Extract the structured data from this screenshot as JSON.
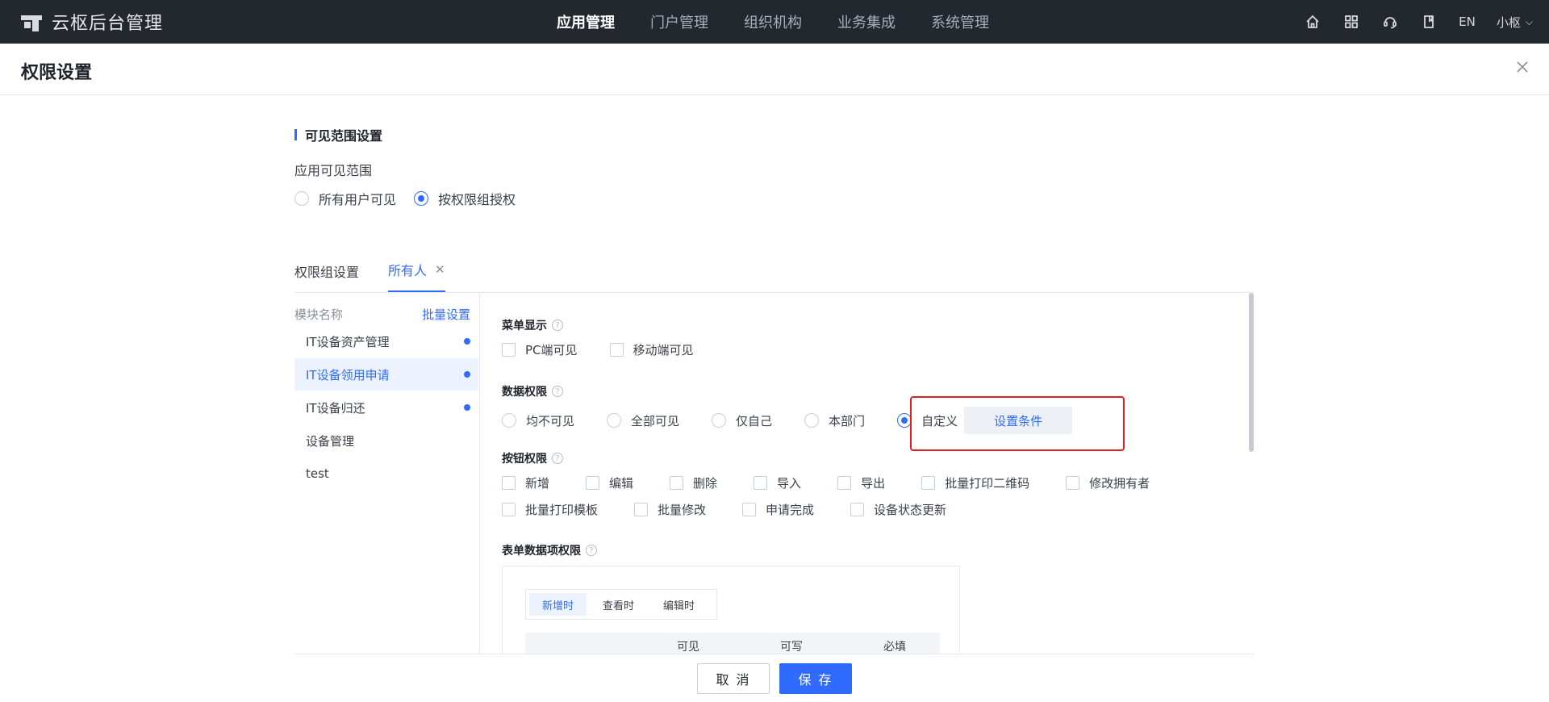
{
  "app": {
    "brand": "云枢后台管理"
  },
  "nav": [
    {
      "label": "应用管理",
      "active": true
    },
    {
      "label": "门户管理"
    },
    {
      "label": "组织机构"
    },
    {
      "label": "业务集成"
    },
    {
      "label": "系统管理"
    }
  ],
  "topright": {
    "lang": "EN",
    "user": "小枢"
  },
  "page": {
    "title": "权限设置"
  },
  "visibility": {
    "section_title": "可见范围设置",
    "label": "应用可见范围",
    "options": [
      {
        "label": "所有用户可见",
        "selected": false
      },
      {
        "label": "按权限组授权",
        "selected": true
      }
    ]
  },
  "tabs": [
    {
      "label": "权限组设置"
    },
    {
      "label": "所有人",
      "active": true
    }
  ],
  "modules": {
    "header": "模块名称",
    "batch": "批量设置",
    "items": [
      {
        "label": "IT设备资产管理",
        "dot": true
      },
      {
        "label": "IT设备领用申请",
        "dot": true,
        "selected": true
      },
      {
        "label": "IT设备归还",
        "dot": true
      },
      {
        "label": "设备管理",
        "dot": false
      },
      {
        "label": "test",
        "dot": false
      }
    ]
  },
  "menu_display": {
    "title": "菜单显示",
    "options": [
      "PC端可见",
      "移动端可见"
    ]
  },
  "data_permission": {
    "title": "数据权限",
    "options": [
      "均不可见",
      "全部可见",
      "仅自己",
      "本部门",
      "自定义"
    ],
    "selected": "自定义",
    "set_condition": "设置条件"
  },
  "button_permission": {
    "title": "按钮权限",
    "row1": [
      "新增",
      "编辑",
      "删除",
      "导入",
      "导出",
      "批量打印二维码",
      "修改拥有者"
    ],
    "row2": [
      "批量打印模板",
      "批量修改",
      "申请完成",
      "设备状态更新"
    ]
  },
  "form_permission": {
    "title": "表单数据项权限",
    "subtabs": [
      "新增时",
      "查看时",
      "编辑时"
    ],
    "columns": [
      "可见",
      "可写",
      "必填"
    ]
  },
  "footer": {
    "cancel": "取 消",
    "save": "保 存"
  },
  "colors": {
    "accent": "#2f6bff",
    "highlight": "#e02020",
    "topbar": "#23272e"
  }
}
